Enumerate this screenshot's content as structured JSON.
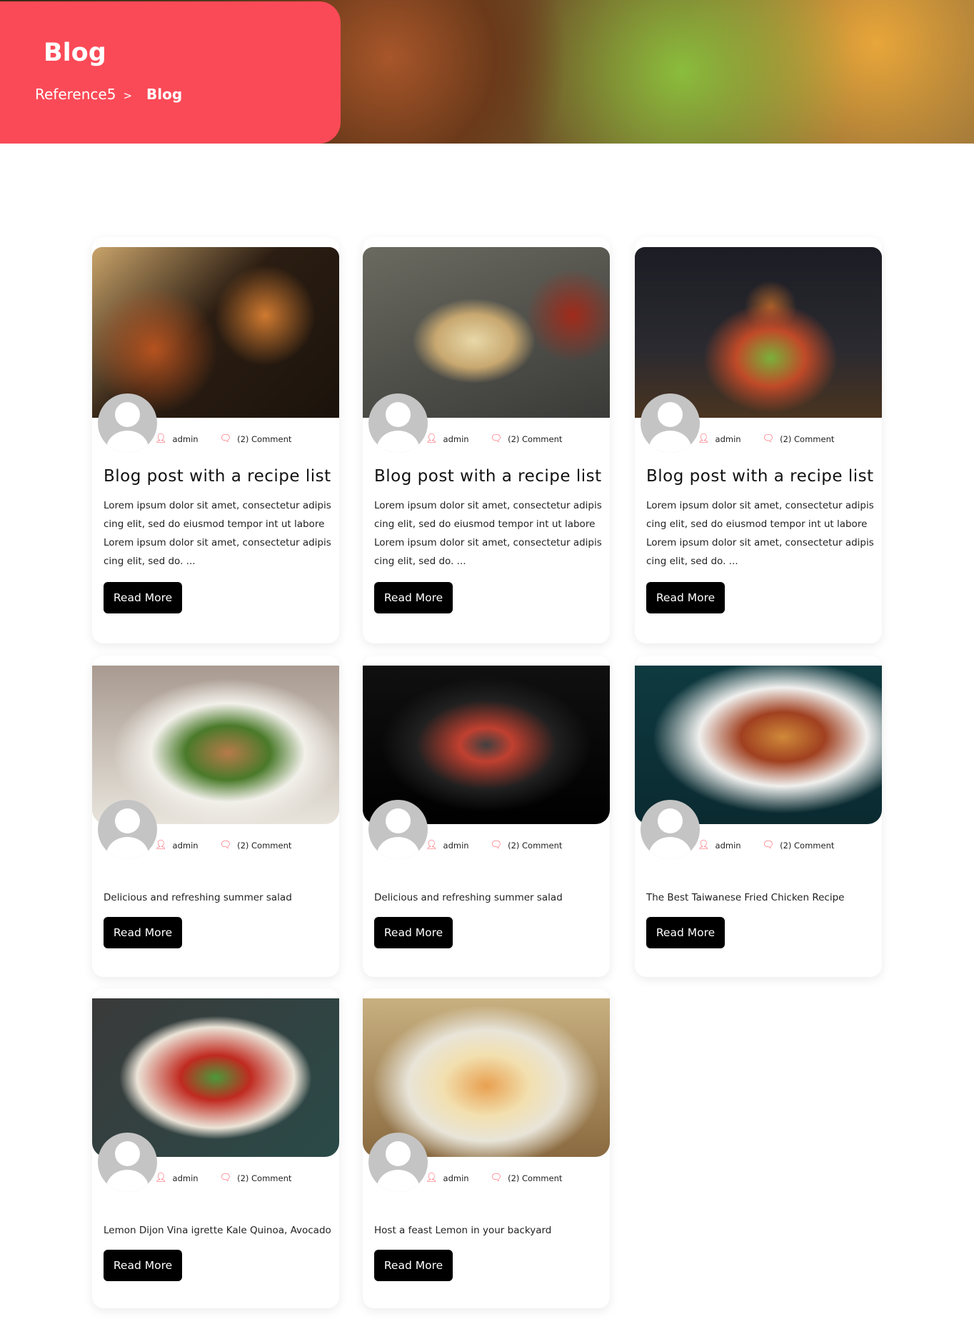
{
  "header": {
    "title": "Blog",
    "breadcrumb": [
      {
        "label": "Reference5"
      },
      {
        "label": "Blog"
      }
    ],
    "separator": ">"
  },
  "colors": {
    "accent": "#fb4a57",
    "button": "#000000"
  },
  "read_more": "Read More",
  "posts": [
    {
      "author": "admin",
      "comments": "(2) Comment",
      "title": "Blog post with a recipe list",
      "excerpt": "Lorem ipsum dolor sit amet, consectetur adipis cing elit, sed do eiusmod tempor int ut labore Lorem ipsum dolor sit amet, consectetur adipis cing elit, sed do. ..."
    },
    {
      "author": "admin",
      "comments": "(2) Comment",
      "title": "Blog post with a recipe list",
      "excerpt": "Lorem ipsum dolor sit amet, consectetur adipis cing elit, sed do eiusmod tempor int ut labore Lorem ipsum dolor sit amet, consectetur adipis cing elit, sed do. ..."
    },
    {
      "author": "admin",
      "comments": "(2) Comment",
      "title": "Blog post with a recipe list",
      "excerpt": "Lorem ipsum dolor sit amet, consectetur adipis cing elit, sed do eiusmod tempor int ut labore Lorem ipsum dolor sit amet, consectetur adipis cing elit, sed do. ..."
    },
    {
      "author": "admin",
      "comments": "(2) Comment",
      "excerpt": "Delicious and refreshing summer salad"
    },
    {
      "author": "admin",
      "comments": "(2) Comment",
      "excerpt": "Delicious and refreshing summer salad"
    },
    {
      "author": "admin",
      "comments": "(2) Comment",
      "excerpt": "The Best Taiwanese Fried Chicken Recipe"
    },
    {
      "author": "admin",
      "comments": "(2) Comment",
      "excerpt": "Lemon Dijon Vina igrette Kale Quinoa, Avocado"
    },
    {
      "author": "admin",
      "comments": "(2) Comment",
      "excerpt": "Host a feast Lemon in your backyard"
    }
  ]
}
